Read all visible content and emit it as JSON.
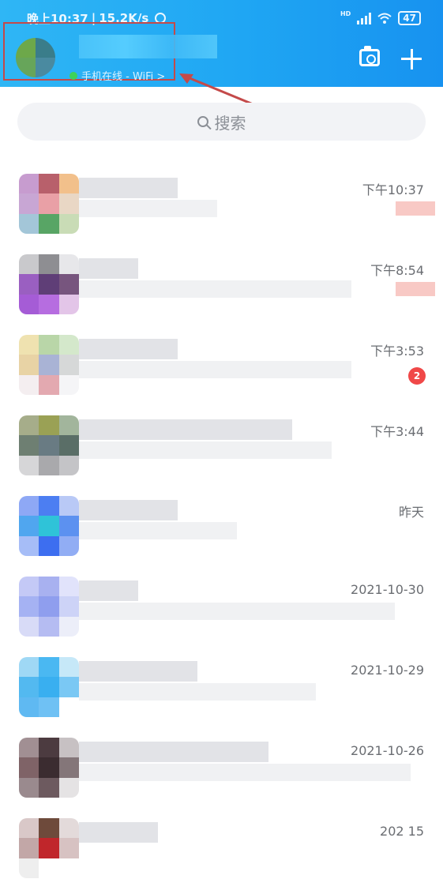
{
  "status_bar": {
    "time": "晚上10:37",
    "speed": "15.2K/s",
    "hd": "HD",
    "battery": "47"
  },
  "header": {
    "online_status": "手机在线 - WiFi >"
  },
  "search": {
    "placeholder": "搜索"
  },
  "conversations": [
    {
      "time": "下午10:37",
      "badge": ""
    },
    {
      "time": "下午8:54",
      "badge": ""
    },
    {
      "time": "下午3:53",
      "badge": "2"
    },
    {
      "time": "下午3:44",
      "badge": ""
    },
    {
      "time": "昨天",
      "badge": ""
    },
    {
      "time": "2021-10-30",
      "badge": ""
    },
    {
      "time": "2021-10-29",
      "badge": ""
    },
    {
      "time": "2021-10-26",
      "badge": ""
    },
    {
      "time": "202 15",
      "badge": ""
    }
  ],
  "colors": {
    "header_blue": "#1fa6f3",
    "annotation_red": "#c44a4a",
    "badge_red": "#f04848"
  },
  "icons": [
    "alarm-icon",
    "signal-icon",
    "wifi-icon",
    "battery-icon",
    "camera-icon",
    "plus-icon",
    "search-icon"
  ]
}
